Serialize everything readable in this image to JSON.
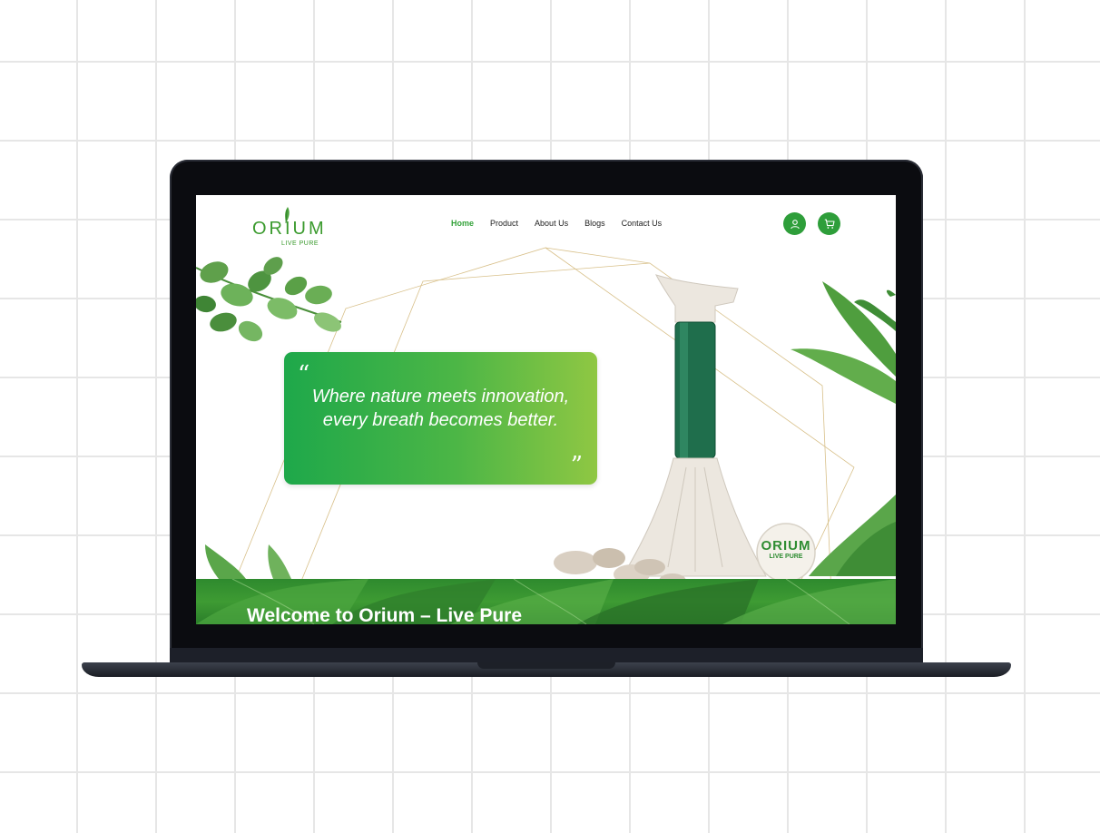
{
  "brand": {
    "name": "ORIUM",
    "tagline": "LIVE PURE",
    "color": "#3a9a2d"
  },
  "nav": {
    "items": [
      {
        "label": "Home",
        "active": true
      },
      {
        "label": "Product",
        "active": false
      },
      {
        "label": "About Us",
        "active": false
      },
      {
        "label": "Blogs",
        "active": false
      },
      {
        "label": "Contact Us",
        "active": false
      }
    ]
  },
  "header_icons": {
    "account": "user-icon",
    "cart": "cart-icon",
    "color": "#2e9e3a"
  },
  "hero": {
    "quote_open": "“",
    "quote_close": "”",
    "quote": "Where nature meets innovation, every breath becomes better.",
    "gradient": [
      "#1ea84a",
      "#8fc743"
    ]
  },
  "product_badge": {
    "name": "ORIUM",
    "tagline": "LIVE PURE"
  },
  "banner": {
    "title": "Welcome to  Orium – Live Pure"
  }
}
